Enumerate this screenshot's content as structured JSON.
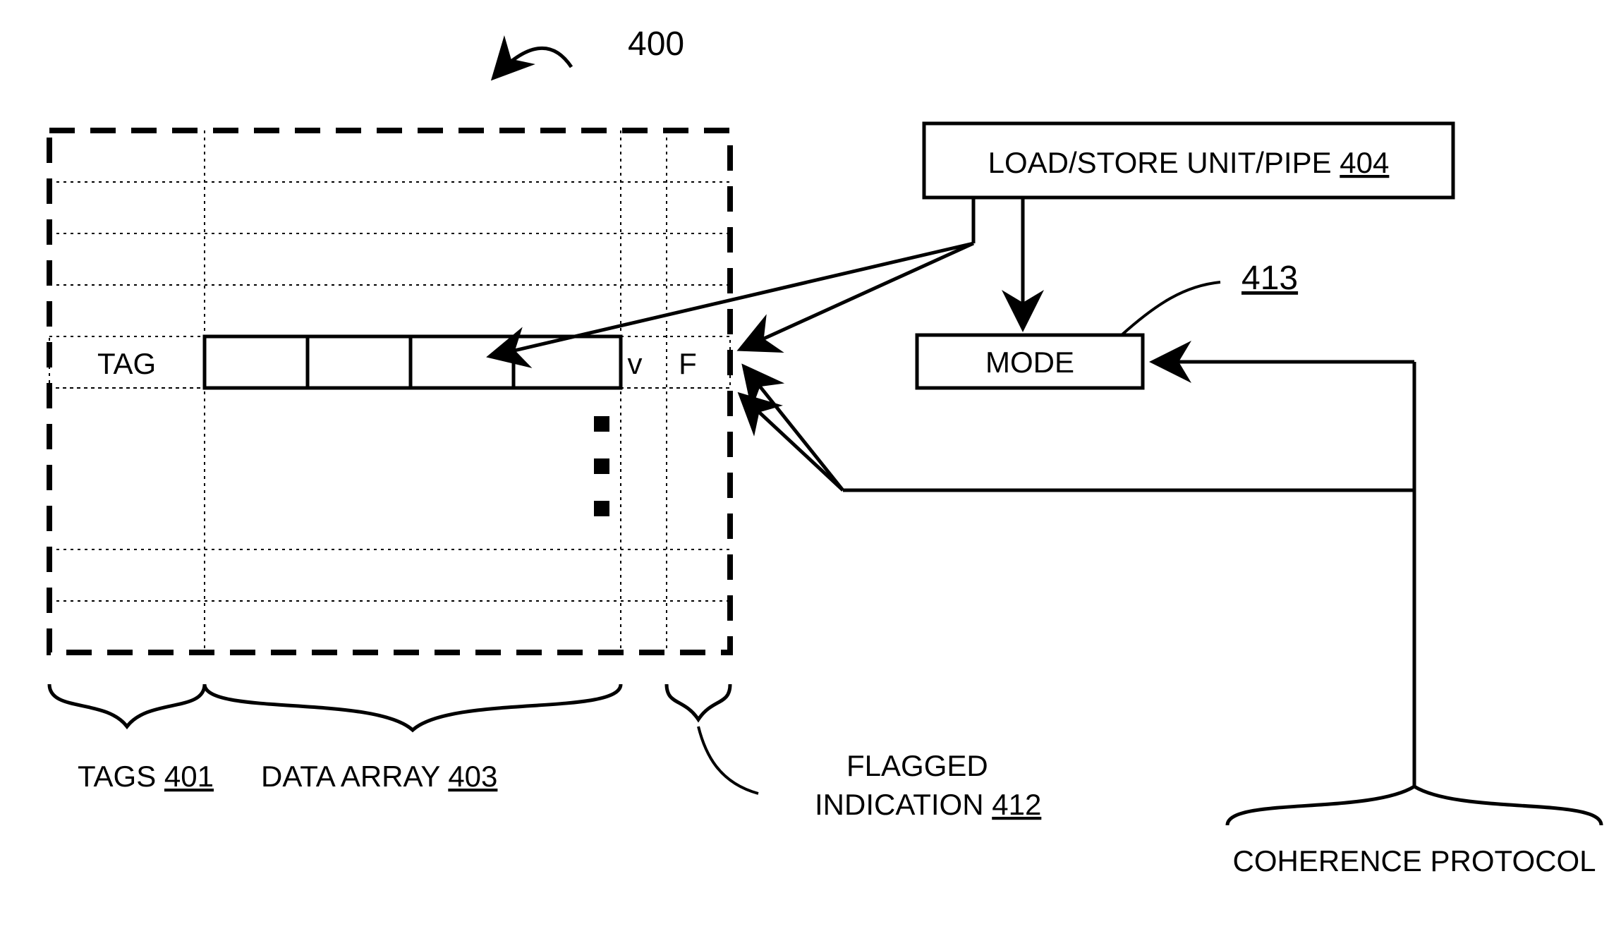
{
  "figure_ref": "400",
  "cache_row": {
    "tag_label": "TAG",
    "valid_bit": "v",
    "flag_bit": "F"
  },
  "blocks": {
    "loadstore": {
      "text": "LOAD/STORE UNIT/PIPE ",
      "num": "404"
    },
    "mode": "MODE",
    "mode_ref": "413"
  },
  "bottom_labels": {
    "tags_text": "TAGS ",
    "tags_num": "401",
    "data_array_text": "DATA ARRAY ",
    "data_array_num": "403",
    "flagged_line1": "FLAGGED",
    "flagged_line2_text": "INDICATION ",
    "flagged_line2_num": "412",
    "coherence": "COHERENCE PROTOCOL"
  }
}
